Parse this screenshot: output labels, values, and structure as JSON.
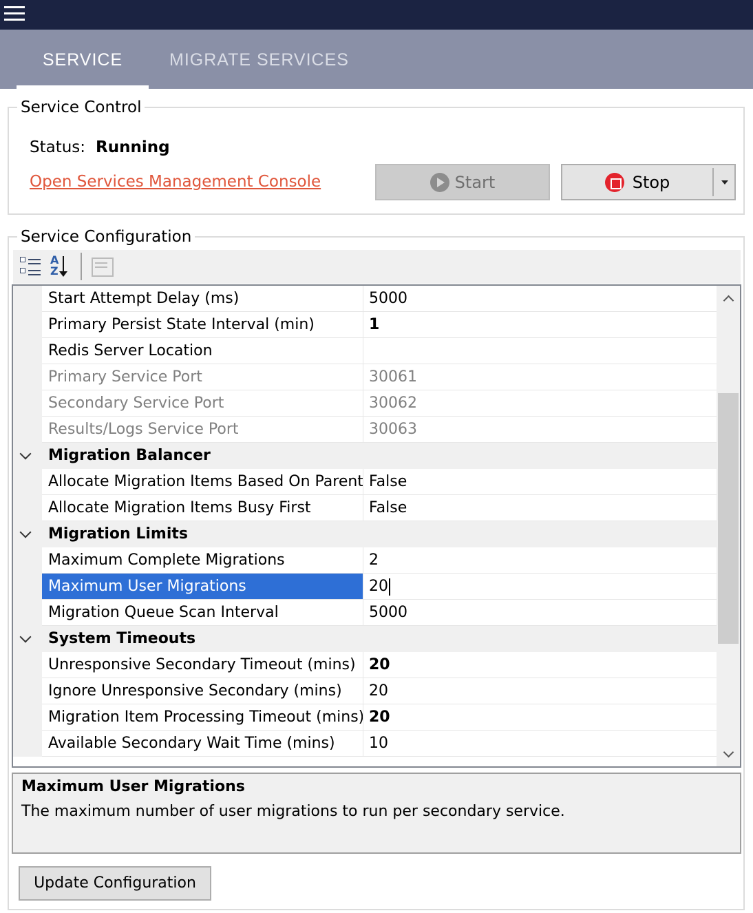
{
  "tabs": [
    {
      "label": "SERVICE",
      "active": true
    },
    {
      "label": "MIGRATE SERVICES",
      "active": false
    }
  ],
  "service_control": {
    "title": "Service Control",
    "status_label": "Status:",
    "status_value": "Running",
    "console_link": "Open Services Management Console",
    "start_label": "Start",
    "stop_label": "Stop"
  },
  "service_configuration": {
    "title": "Service Configuration",
    "rows": [
      {
        "name": "Start Attempt Delay (ms)",
        "value": "5000"
      },
      {
        "name": "Primary Persist State Interval (min)",
        "value": "1"
      },
      {
        "name": "Redis Server Location",
        "value": ""
      },
      {
        "name": "Primary Service Port",
        "value": "30061"
      },
      {
        "name": "Secondary Service Port",
        "value": "30062"
      },
      {
        "name": "Results/Logs Service Port",
        "value": "30063"
      },
      {
        "name": "Migration Balancer",
        "value": ""
      },
      {
        "name": "Allocate Migration Items Based On Parent",
        "value": "False"
      },
      {
        "name": "Allocate Migration Items Busy First",
        "value": "False"
      },
      {
        "name": "Migration Limits",
        "value": ""
      },
      {
        "name": "Maximum Complete Migrations",
        "value": "2"
      },
      {
        "name": "Maximum User Migrations",
        "value": "20"
      },
      {
        "name": "Migration Queue Scan Interval",
        "value": "5000"
      },
      {
        "name": "System Timeouts",
        "value": ""
      },
      {
        "name": "Unresponsive Secondary Timeout (mins)",
        "value": "20"
      },
      {
        "name": "Ignore Unresponsive Secondary (mins)",
        "value": "20"
      },
      {
        "name": "Migration Item Processing Timeout (mins)",
        "value": "20"
      },
      {
        "name": "Available Secondary Wait Time (mins)",
        "value": "10"
      }
    ],
    "help_title": "Maximum User Migrations",
    "help_description": "The maximum number of user migrations to run per secondary service.",
    "update_label": "Update Configuration"
  },
  "colors": {
    "topbar": "#1b2342",
    "tabbar": "#8a90a7",
    "link": "#e0563b",
    "selection": "#2e6fd6",
    "stop_icon": "#e3232c"
  },
  "icons": [
    "menu-icon",
    "play-icon",
    "stop-icon",
    "dropdown-arrow-icon",
    "categorized-icon",
    "alphabetical-sort-icon",
    "property-pages-icon",
    "scroll-up-icon",
    "scroll-down-icon"
  ]
}
